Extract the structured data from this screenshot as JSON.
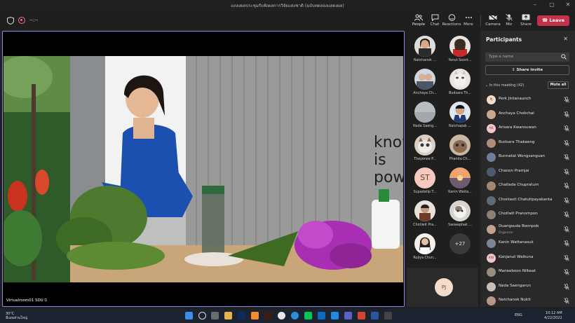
{
  "window": {
    "title": "แถลงผลประชุมรับฟังผลการวิจัยแห่งชาติ (ฉบับทดลองแสดงผล)",
    "minimize": "–",
    "maximize": "▢",
    "close": "✕"
  },
  "meeting": {
    "timer": "--:--",
    "toolbar": {
      "people": "People",
      "chat": "Chat",
      "reactions": "Reactions",
      "more": "More",
      "camera": "Camera",
      "mic": "Mic",
      "share": "Share",
      "leave": "Leave"
    },
    "stage_name": "Virtualroom01 SDU",
    "video_text": [
      "know",
      "is",
      "pow"
    ]
  },
  "gallery": [
    {
      "name": "Natchanok ..."
    },
    {
      "name": "Yanut Soont..."
    },
    {
      "name": "Anchaya Ch..."
    },
    {
      "name": "Budsara Th..."
    },
    {
      "name": "Nada Saeng..."
    },
    {
      "name": "Natchapak ..."
    },
    {
      "name": "Thayanee P..."
    },
    {
      "name": "Phanita Ch..."
    },
    {
      "name": "Supadatip T...",
      "initials": "ST"
    },
    {
      "name": "Kanin Watta..."
    },
    {
      "name": "Chotiwit Pra..."
    },
    {
      "name": "Saowaphak ..."
    },
    {
      "name": "Rujiya Chun..."
    },
    {
      "more": "+27"
    }
  ],
  "self_tile": {
    "initials": "PJ"
  },
  "participants_panel": {
    "title": "Participants",
    "search_placeholder": "Type a name",
    "share_invite": "Share invite",
    "in_meeting": "In this meeting (42)",
    "mute_all": "Mute all",
    "people": [
      {
        "name": "Perk Jintanaunch",
        "initials": "PJ",
        "color": "#f5dcc8"
      },
      {
        "name": "Anchaya Chokchai",
        "color": "#c9a98c"
      },
      {
        "name": "Arisara Kwansuwan",
        "initials": "AK",
        "color": "#f3c6cf"
      },
      {
        "name": "Budsara Thakaeng",
        "color": "#b08f7a"
      },
      {
        "name": "Bunnatat Wongsanguan",
        "color": "#6d7f9b"
      },
      {
        "name": "Chanon Pramjai",
        "color": "#4c5a70"
      },
      {
        "name": "Chatlada Chupratum",
        "color": "#a38773"
      },
      {
        "name": "Chonlasit Chatutipayakanta",
        "color": "#5a6d7a"
      },
      {
        "name": "Chotiwit Pranompon",
        "color": "#8c7f74"
      },
      {
        "name": "Duangsuda Boonpob",
        "role": "Organizer",
        "color": "#c2a28d"
      },
      {
        "name": "Kanin Wattanasuk",
        "color": "#7b8796"
      },
      {
        "name": "Kanjanut Waikuna",
        "initials": "KW",
        "color": "#f3c6cf"
      },
      {
        "name": "Maneeboon Nilkeat",
        "color": "#9a8b7f"
      },
      {
        "name": "Nada Saengarun",
        "color": "#c9bfb8"
      },
      {
        "name": "Natchanok Nukit",
        "color": "#b79887"
      }
    ]
  },
  "taskbar": {
    "temp": "30°C",
    "weather": "มีเมฆส่วนใหญ่",
    "lang": "ENG",
    "time": "10:12 AM",
    "date": "4/22/2022"
  }
}
